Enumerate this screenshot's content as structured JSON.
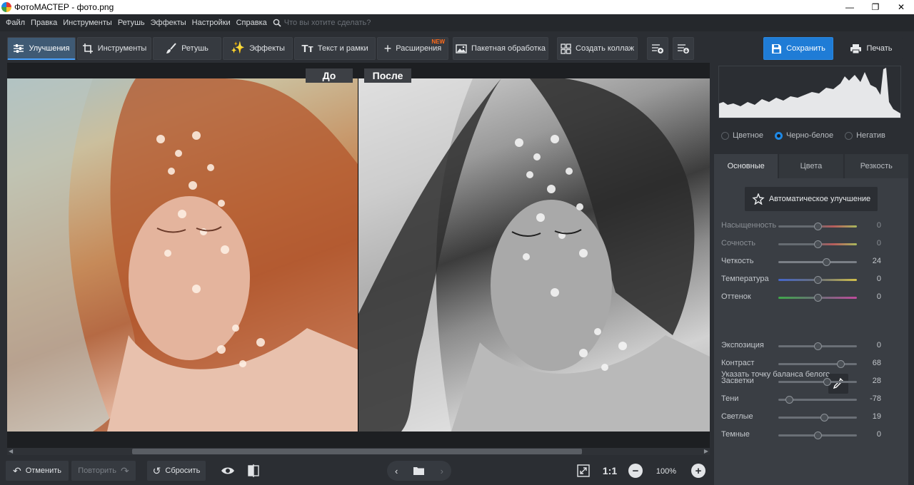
{
  "window": {
    "title": "ФотоМАСТЕР - фото.png",
    "controls": [
      "—",
      "❐",
      "✕"
    ]
  },
  "menu": {
    "items": [
      "Файл",
      "Правка",
      "Инструменты",
      "Ретушь",
      "Эффекты",
      "Настройки",
      "Справка"
    ],
    "search_placeholder": "Что вы хотите сделать?"
  },
  "toolbar": {
    "tabs": [
      {
        "label": "Улучшения",
        "icon": "sliders-icon",
        "active": true
      },
      {
        "label": "Инструменты",
        "icon": "crop-icon"
      },
      {
        "label": "Ретушь",
        "icon": "brush-icon"
      },
      {
        "label": "Эффекты",
        "icon": "sparkle-icon"
      },
      {
        "label": "Текст и рамки",
        "icon": "text-icon"
      },
      {
        "label": "Расширения",
        "icon": "plus-icon",
        "badge": "NEW"
      }
    ],
    "batch_label": "Пакетная обработка",
    "collage_label": "Создать коллаж",
    "save_label": "Сохранить",
    "print_label": "Печать"
  },
  "canvas": {
    "before_label": "До",
    "after_label": "После"
  },
  "bottom": {
    "undo_label": "Отменить",
    "redo_label": "Повторить",
    "reset_label": "Сбросить",
    "zoom_ratio": "1:1",
    "zoom_percent": "100%"
  },
  "panel": {
    "modes": [
      {
        "label": "Цветное",
        "selected": false
      },
      {
        "label": "Черно-белое",
        "selected": true
      },
      {
        "label": "Негатив",
        "selected": false
      }
    ],
    "tabs": [
      "Основные",
      "Цвета",
      "Резкость"
    ],
    "auto_label": "Автоматическое улучшение",
    "white_balance_label": "Указать точку баланса белого",
    "sliders_top": [
      {
        "label": "Насыщенность",
        "value": "0",
        "dim": true,
        "gradient": "saturation"
      },
      {
        "label": "Сочность",
        "value": "0",
        "dim": true,
        "gradient": "saturation"
      },
      {
        "label": "Четкость",
        "value": "24",
        "dim": false,
        "gradient": "gray"
      },
      {
        "label": "Температура",
        "value": "0",
        "dim": false,
        "gradient": "temperature"
      },
      {
        "label": "Оттенок",
        "value": "0",
        "dim": false,
        "gradient": "tint"
      }
    ],
    "sliders_bottom": [
      {
        "label": "Экспозиция",
        "value": "0"
      },
      {
        "label": "Контраст",
        "value": "68"
      },
      {
        "label": "Засветки",
        "value": "28"
      },
      {
        "label": "Тени",
        "value": "-78"
      },
      {
        "label": "Светлые",
        "value": "19"
      },
      {
        "label": "Темные",
        "value": "0"
      }
    ]
  },
  "colors": {
    "accent": "#1e88e5",
    "save": "#1f7cd6",
    "new_badge": "#ff6a1a"
  }
}
